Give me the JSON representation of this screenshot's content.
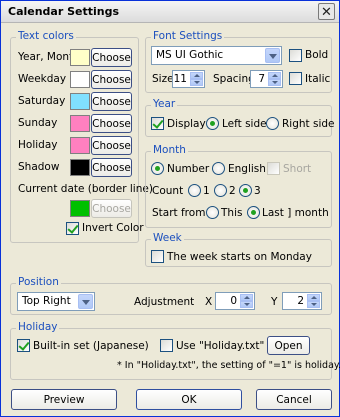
{
  "window": {
    "title": "Calendar Settings",
    "close_glyph": "✕"
  },
  "text_colors": {
    "legend": "Text colors",
    "choose_label": "Choose",
    "rows": [
      {
        "label": "Year, Month",
        "color": "#ffffc8"
      },
      {
        "label": "Weekday",
        "color": "#ffffff"
      },
      {
        "label": "Saturday",
        "color": "#80e0ff"
      },
      {
        "label": "Sunday",
        "color": "#ff80c0"
      },
      {
        "label": "Holiday",
        "color": "#ff80c0"
      },
      {
        "label": "Shadow",
        "color": "#000000"
      }
    ],
    "current_date_label": "Current date (border line)",
    "current_date_color": "#00c000",
    "invert_label": "Invert Color",
    "invert_checked": true
  },
  "font": {
    "legend": "Font Settings",
    "family": "MS UI Gothic",
    "bold_label": "Bold",
    "italic_label": "Italic",
    "size_label": "Size",
    "size_value": "11",
    "spacing_label": "Spacing",
    "spacing_value": "7"
  },
  "year": {
    "legend": "Year",
    "display_label": "Display",
    "left_label": "Left side",
    "right_label": "Right side"
  },
  "month": {
    "legend": "Month",
    "number_label": "Number",
    "english_label": "English",
    "short_label": "Short",
    "count_label": "Count",
    "count_1": "1",
    "count_2": "2",
    "count_3": "3",
    "start_label": "Start from [",
    "this_label": "This",
    "last_label": "Last ] month"
  },
  "week": {
    "legend": "Week",
    "monday_label": "The week starts on Monday"
  },
  "position": {
    "legend": "Position",
    "value": "Top Right",
    "adjust_label": "Adjustment",
    "x_label": "X",
    "x_value": "0",
    "y_label": "Y",
    "y_value": "2"
  },
  "holiday": {
    "legend": "Holiday",
    "builtin_label": "Built-in set (Japanese)",
    "use_file_label": "Use \"Holiday.txt\"",
    "open_label": "Open",
    "note": "* In \"Holiday.txt\", the setting of \"=1\" is holiday."
  },
  "footer": {
    "preview": "Preview",
    "ok": "OK",
    "cancel": "Cancel"
  }
}
